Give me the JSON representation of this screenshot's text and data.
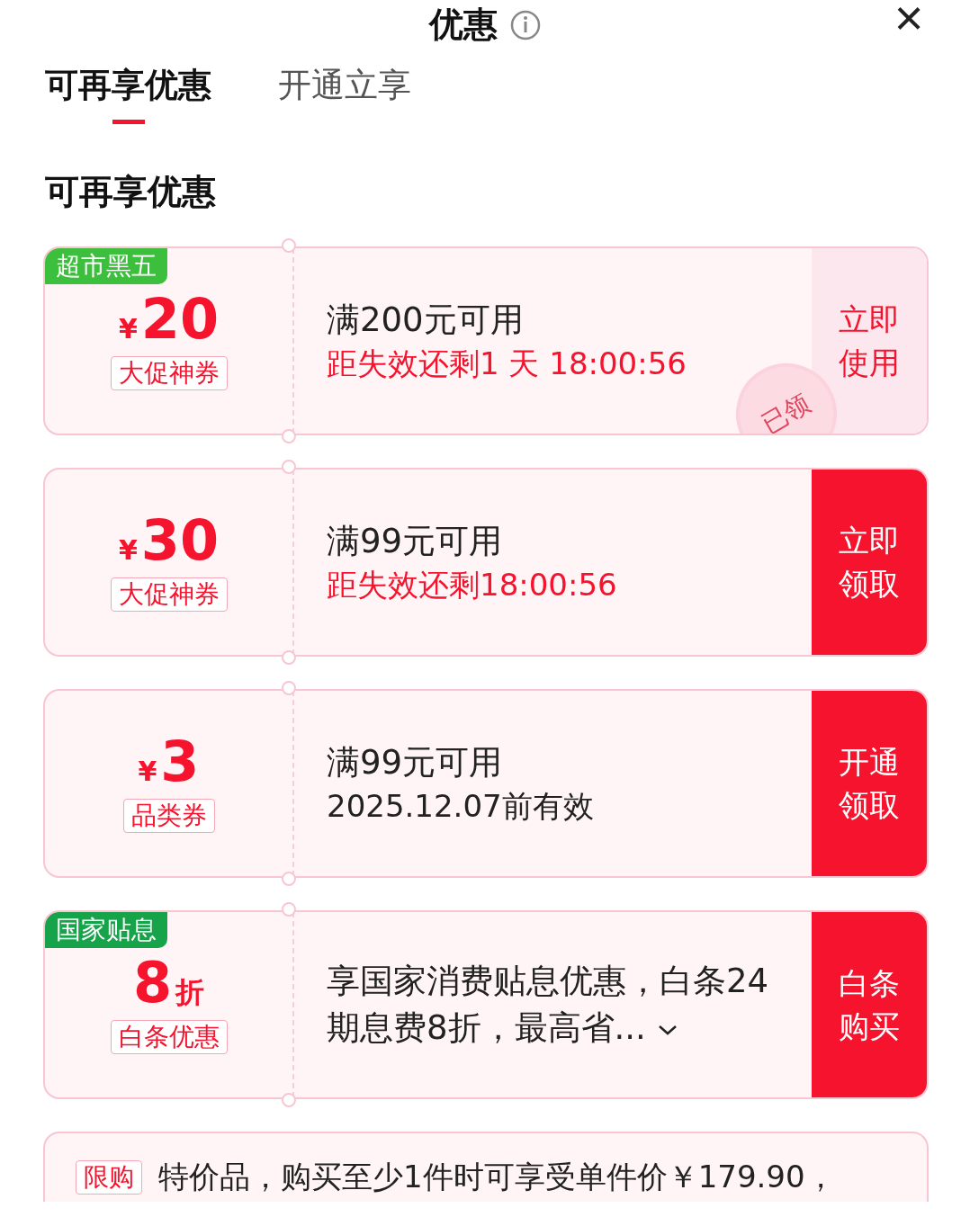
{
  "header": {
    "title": "优惠",
    "close": "×"
  },
  "tabs": [
    {
      "label": "可再享优惠",
      "selected": true
    },
    {
      "label": "开通立享",
      "selected": false
    }
  ],
  "section_title": "可再享优惠",
  "coupons": [
    {
      "kind": "amount",
      "tag": {
        "text": "超市黑五",
        "color": "#3cbf3c"
      },
      "currency": "¥",
      "value": "20",
      "label": "大促神券",
      "condition": "满200元可用",
      "validity": "距失效还剩1 天 18:00:56",
      "urgent": true,
      "expandable": false,
      "action": "立即使用",
      "claimed": true,
      "stamp": "已领"
    },
    {
      "kind": "amount",
      "currency": "¥",
      "value": "30",
      "label": "大促神券",
      "condition": "满99元可用",
      "validity": "距失效还剩18:00:56",
      "urgent": true,
      "expandable": false,
      "action": "立即领取",
      "claimed": false
    },
    {
      "kind": "amount",
      "currency": "¥",
      "value": "3",
      "label": "品类券",
      "condition": "满99元可用",
      "validity": "2025.12.07前有效",
      "urgent": false,
      "expandable": false,
      "action": "开通领取",
      "claimed": false
    },
    {
      "kind": "discount",
      "tag": {
        "text": "国家贴息",
        "color": "#16a34a"
      },
      "value": "8",
      "unit": "折",
      "label": "白条优惠",
      "condition": "享国家消费贴息优惠，白条24期息费8折，最高省...",
      "expandable": true,
      "action": "白条购买",
      "claimed": false
    }
  ],
  "notice": {
    "badge": "限购",
    "text": "特价品，购买至少1件时可享受单件价￥179.90，"
  }
}
